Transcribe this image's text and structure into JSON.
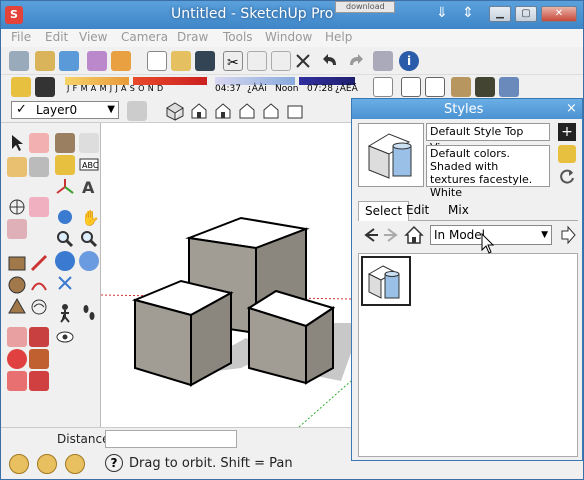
{
  "window": {
    "title": "Untitled - SketchUp Pro",
    "app_icon": "sketchup-logo-icon",
    "background_tab": "download"
  },
  "menu": [
    "File",
    "Edit",
    "View",
    "Camera",
    "Draw",
    "Tools",
    "Window",
    "Help"
  ],
  "shadow_bar": {
    "months": [
      "J",
      "F",
      "M",
      "A",
      "M",
      "J",
      "J",
      "A",
      "S",
      "O",
      "N",
      "D"
    ],
    "time_start": "04:37",
    "time_start_suffix": "¿ÀÀi",
    "noon": "Noon",
    "time_end": "07:28",
    "time_end_suffix": "¿ÀÈÄ"
  },
  "layer": {
    "current": "Layer0"
  },
  "status": {
    "measurements_label": "Distance",
    "measurements_value": "",
    "hint": "Drag to orbit.  Shift = Pan",
    "help": "?"
  },
  "styles_panel": {
    "title": "Styles",
    "close": "×",
    "style_name": "Default Style Top View",
    "style_description": "Default colors.  Shaded with textures facestyle.  White",
    "tabs": [
      "Select",
      "Edit",
      "Mix"
    ],
    "active_tab": "Select",
    "collection": "In Model"
  },
  "colors": {
    "titlebar": "#4b92d2",
    "cube_face_top": "#ffffff",
    "cube_face_side": "#a19d94",
    "cube_face_dark": "#8b877e",
    "ground_shadow": "#c8c8c8",
    "axis_red": "#cc3333",
    "axis_green": "#33aa33"
  }
}
